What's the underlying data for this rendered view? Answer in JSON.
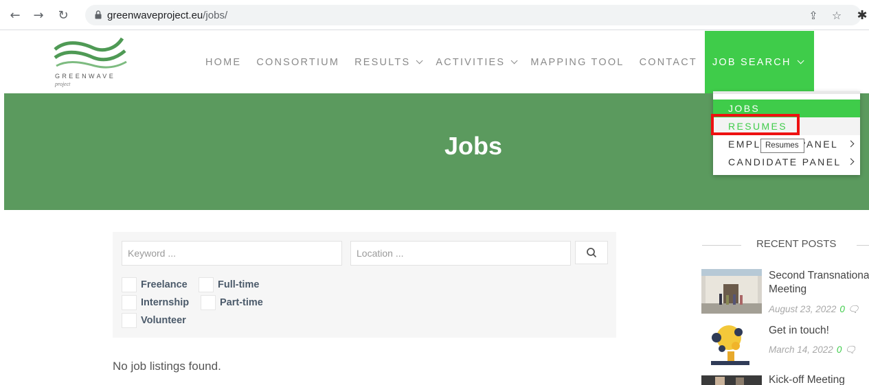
{
  "browser": {
    "url_host": "greenwaveproject.eu",
    "url_path": "/jobs/"
  },
  "site": {
    "logo_text": "GREENWAVE",
    "logo_sub": "project",
    "menu": [
      {
        "label": "HOME"
      },
      {
        "label": "CONSORTIUM"
      },
      {
        "label": "RESULTS"
      },
      {
        "label": "ACTIVITIES"
      },
      {
        "label": "MAPPING TOOL"
      },
      {
        "label": "CONTACT"
      },
      {
        "label": "JOB SEARCH"
      }
    ],
    "dropdown": {
      "jobs": "JOBS",
      "resumes": "RESUMES",
      "employer": "EMPLOYER PANEL",
      "candidate": "CANDIDATE PANEL",
      "tooltip": "Resumes"
    },
    "colors": {
      "accent": "#3fcc4a",
      "hero": "#5b9a5e"
    }
  },
  "hero": {
    "title": "Jobs"
  },
  "search": {
    "keyword_placeholder": "Keyword ...",
    "location_placeholder": "Location ...",
    "types": [
      "Freelance",
      "Full-time",
      "Internship",
      "Part-time",
      "Volunteer"
    ],
    "empty_message": "No job listings found."
  },
  "sidebar": {
    "title": "RECENT POSTS",
    "posts": [
      {
        "title": "Second Transnational",
        "title_line2": "Meeting",
        "date": "August 23, 2022",
        "comments": "0"
      },
      {
        "title": "Get in touch!",
        "date": "March 14, 2022",
        "comments": "0"
      },
      {
        "title": "Kick-off Meeting"
      }
    ]
  }
}
